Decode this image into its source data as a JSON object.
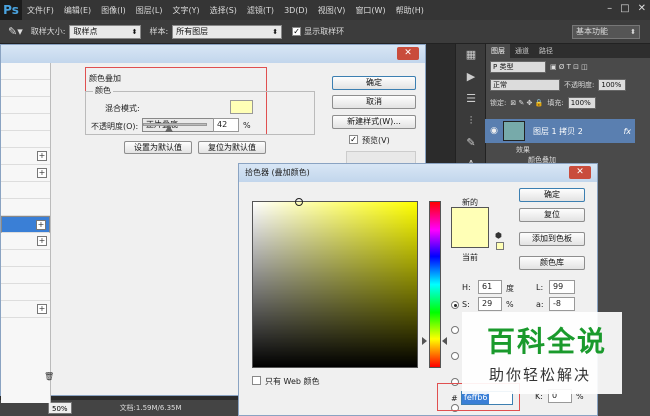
{
  "app": {
    "logo": "Ps"
  },
  "menubar": [
    "文件(F)",
    "编辑(E)",
    "图像(I)",
    "图层(L)",
    "文字(Y)",
    "选择(S)",
    "滤镜(T)",
    "3D(D)",
    "视图(V)",
    "窗口(W)",
    "帮助(H)"
  ],
  "options": {
    "sample_size_label": "取样大小:",
    "sample_size_value": "取样点",
    "sample_label": "样本:",
    "sample_value": "所有图层",
    "show_ring_label": "显示取样环",
    "workspace": "基本功能"
  },
  "layers_panel": {
    "tabs": [
      "图层",
      "通道",
      "路径"
    ],
    "kind_label": "P 类型",
    "blend_mode": "正常",
    "opacity_label": "不透明度:",
    "opacity": "100%",
    "lock_label": "锁定:",
    "fill_label": "填充:",
    "fill": "100%",
    "layer_name": "图层 1 拷贝 2",
    "fx": "fx",
    "effects": "效果",
    "effect_item": "颜色叠加"
  },
  "status": {
    "zoom": "50%",
    "doc": "文档:1.59M/6.35M"
  },
  "layer_style": {
    "group_title": "颜色叠加",
    "sub_title": "颜色",
    "blend_label": "混合模式:",
    "blend_value": "正片叠底",
    "opacity_label": "不透明度(O):",
    "opacity_value": "42",
    "pct": "%",
    "set_default": "设置为默认值",
    "reset_default": "复位为默认值",
    "ok": "确定",
    "cancel": "取消",
    "new_style": "新建样式(W)...",
    "preview": "预览(V)",
    "swatch_color": "#ffffb6"
  },
  "color_picker": {
    "title": "拾色器 (叠加颜色)",
    "new_label": "新的",
    "current_label": "当前",
    "ok": "确定",
    "reset": "复位",
    "add_swatch": "添加到色板",
    "libraries": "颜色库",
    "web_only": "只有 Web 颜色",
    "h_label": "H:",
    "h_value": "61",
    "h_unit": "度",
    "s_label": "S:",
    "s_value": "29",
    "s_unit": "%",
    "l_label": "L:",
    "l_value": "99",
    "a_label": "a:",
    "a_value": "-8",
    "k_label": "K:",
    "k_value": "0",
    "k_unit": "%",
    "hash": "#",
    "hex": "feffb6",
    "color": "#ffffb6"
  },
  "watermark": {
    "title": "百科全说",
    "subtitle": "助你轻松解决"
  }
}
